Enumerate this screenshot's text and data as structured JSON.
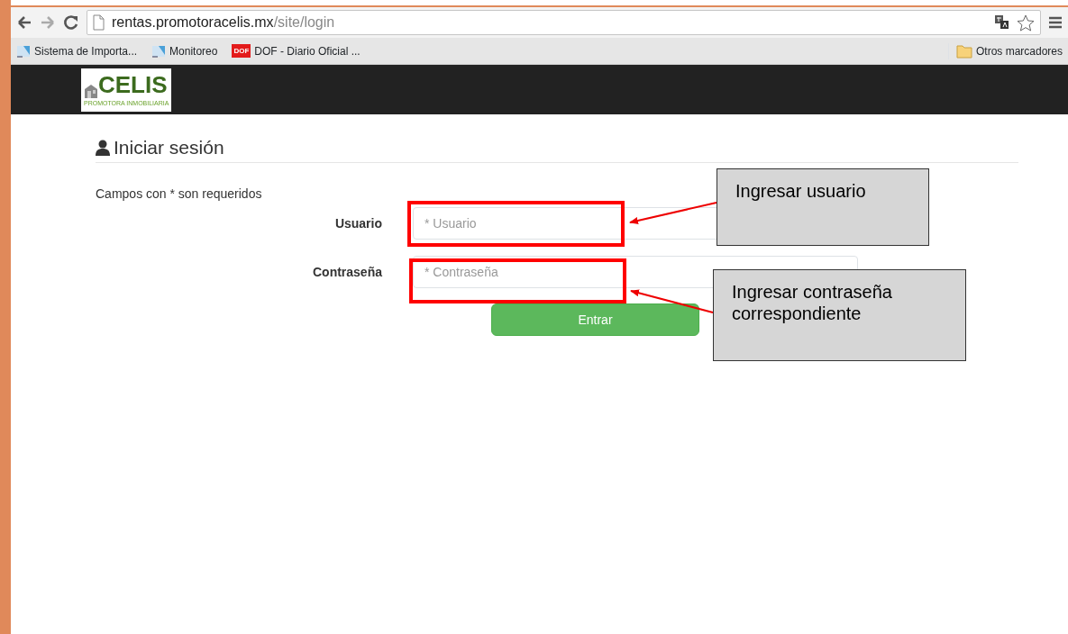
{
  "browser": {
    "address": {
      "host": "rentas.promotoracelis.mx",
      "path": "/site/login"
    },
    "bookmarks": [
      {
        "label": "Sistema de Importa...",
        "kind": "site"
      },
      {
        "label": "Monitoreo",
        "kind": "site"
      },
      {
        "label": "DOF - Diario Oficial ...",
        "kind": "badge",
        "icon_text": "DOF"
      }
    ],
    "other_bookmarks": "Otros marcadores"
  },
  "navbar": {
    "logo": {
      "name": "CELIS",
      "tagline": "PROMOTORA INMOBILIARIA"
    }
  },
  "login": {
    "title": "Iniciar sesión",
    "note": "Campos con * son requeridos",
    "fields": [
      {
        "label": "Usuario",
        "placeholder": "* Usuario"
      },
      {
        "label": "Contraseña",
        "placeholder": "* Contraseña"
      }
    ],
    "submit": "Entrar"
  },
  "annotations": [
    {
      "text": "Ingresar usuario"
    },
    {
      "text": "Ingresar contraseña correspondiente"
    }
  ]
}
